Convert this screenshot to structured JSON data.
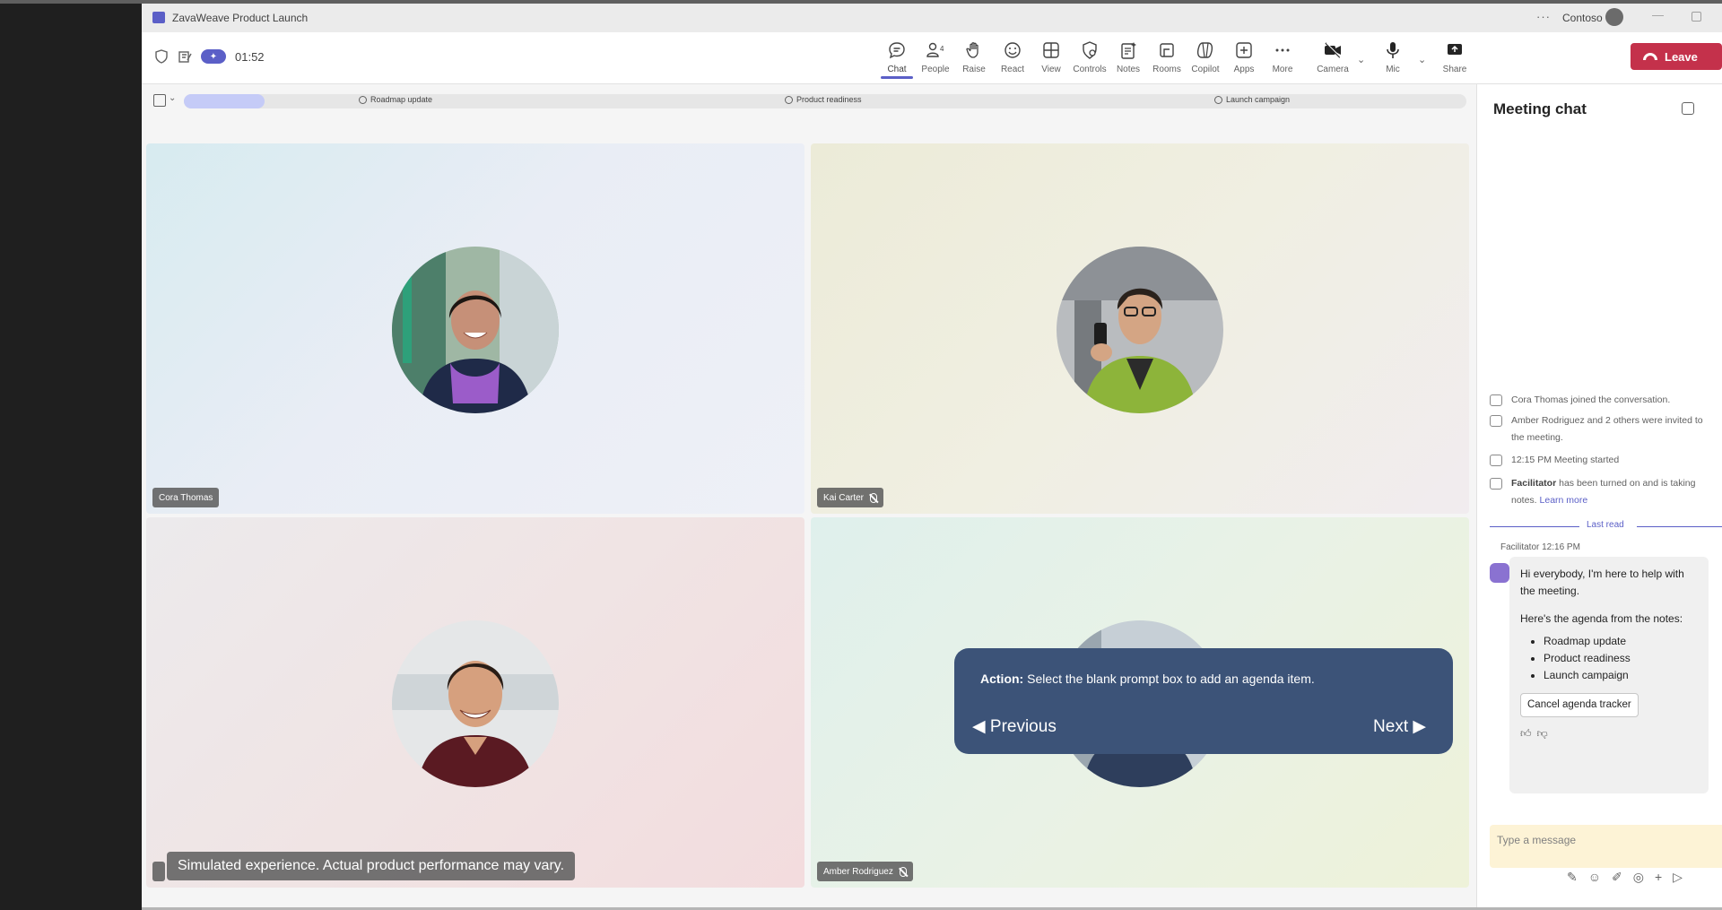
{
  "window": {
    "title": "ZavaWeave Product Launch",
    "more": "···",
    "org": "Contoso",
    "minimize": "—"
  },
  "toolbar": {
    "timer": "01:52",
    "buttons": [
      {
        "label": "Chat"
      },
      {
        "label": "People"
      },
      {
        "label": "Raise"
      },
      {
        "label": "React"
      },
      {
        "label": "View"
      },
      {
        "label": "Controls"
      },
      {
        "label": "Notes"
      },
      {
        "label": "Rooms"
      },
      {
        "label": "Copilot"
      },
      {
        "label": "Apps"
      },
      {
        "label": "More"
      },
      {
        "label": "Camera"
      },
      {
        "label": "Mic"
      },
      {
        "label": "Share"
      }
    ],
    "people_count": "4",
    "leave_label": "Leave"
  },
  "agenda": {
    "items": [
      "Roadmap update",
      "Product readiness",
      "Launch campaign"
    ]
  },
  "participants": [
    {
      "name": "Cora Thomas",
      "muted": false
    },
    {
      "name": "Kai Carter",
      "muted": true
    },
    {
      "name": "",
      "muted": false
    },
    {
      "name": "Amber Rodriguez",
      "muted": true
    }
  ],
  "overlay": {
    "disclaimer": "Simulated experience. Actual product performance may vary.",
    "action_label": "Action:",
    "action_text": "Select the blank prompt box to add an agenda item.",
    "previous": "◀ Previous",
    "next": "Next ▶"
  },
  "chat": {
    "header": "Meeting chat",
    "events": [
      {
        "text": "Cora Thomas joined the conversation."
      },
      {
        "text": "Amber Rodriguez and 2 others were invited to the meeting."
      },
      {
        "text": "12:15 PM   Meeting started"
      },
      {
        "bold": "Facilitator",
        "text": " has been turned on and is taking notes. ",
        "link": "Learn more"
      }
    ],
    "last_read": "Last read",
    "bot_name_time": "Facilitator   12:16 PM",
    "bot_message": {
      "line1": "Hi everybody, I'm here to help with the meeting.",
      "line2": "Here's the agenda from the notes:",
      "items": [
        "Roadmap update",
        "Product readiness",
        "Launch campaign"
      ],
      "button": "Cancel agenda tracker"
    },
    "compose_placeholder": "Type a message"
  },
  "colors": {
    "accent": "#5b5fc7",
    "leave": "#c4314b",
    "coach": "#3c5378"
  }
}
